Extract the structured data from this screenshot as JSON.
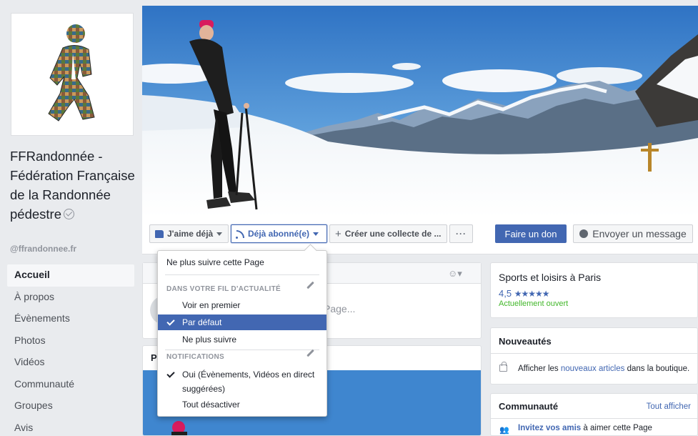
{
  "page": {
    "name": "FFRandonnée - Fédération Française de la Randonnée pédestre",
    "handle": "@ffrandonnee.fr"
  },
  "nav": {
    "items": [
      {
        "label": "Accueil",
        "active": true
      },
      {
        "label": "À propos"
      },
      {
        "label": "Évènements"
      },
      {
        "label": "Photos"
      },
      {
        "label": "Vidéos"
      },
      {
        "label": "Communauté"
      },
      {
        "label": "Groupes"
      },
      {
        "label": "Avis"
      }
    ]
  },
  "actions": {
    "like": "J'aime déjà",
    "subscribe": "Déjà abonné(e)",
    "fundraiser": "Créer une collecte de ...",
    "more": "···",
    "donate": "Faire un don",
    "message": "Envoyer un message"
  },
  "dropdown": {
    "unfollow_page": "Ne plus suivre cette Page",
    "feed_header": "DANS VOTRE FIL D'ACTUALITÉ",
    "see_first": "Voir en premier",
    "default": "Par défaut",
    "unfollow": "Ne plus suivre",
    "notifications_header": "NOTIFICATIONS",
    "notif_on_line1": "Oui (Évènements, Vidéos en direct",
    "notif_on_line2": "suggérées)",
    "notif_off": "Tout désactiver"
  },
  "compose": {
    "placeholder": "Page..."
  },
  "photos": {
    "title": "P"
  },
  "about": {
    "category": "Sports et loisirs à Paris",
    "rating": "4,5",
    "stars": "★★★★★",
    "open_status": "Actuellement ouvert"
  },
  "news": {
    "title": "Nouveautés",
    "text_before": "Afficher les ",
    "link": "nouveaux articles",
    "text_after": " dans la boutique."
  },
  "community": {
    "title": "Communauté",
    "see_all": "Tout afficher",
    "invite_link": "Invitez vos amis",
    "invite_rest": " à aimer cette Page"
  },
  "colors": {
    "brand_blue": "#4267b2",
    "open_green": "#42b72a",
    "background": "#e9ebee"
  }
}
